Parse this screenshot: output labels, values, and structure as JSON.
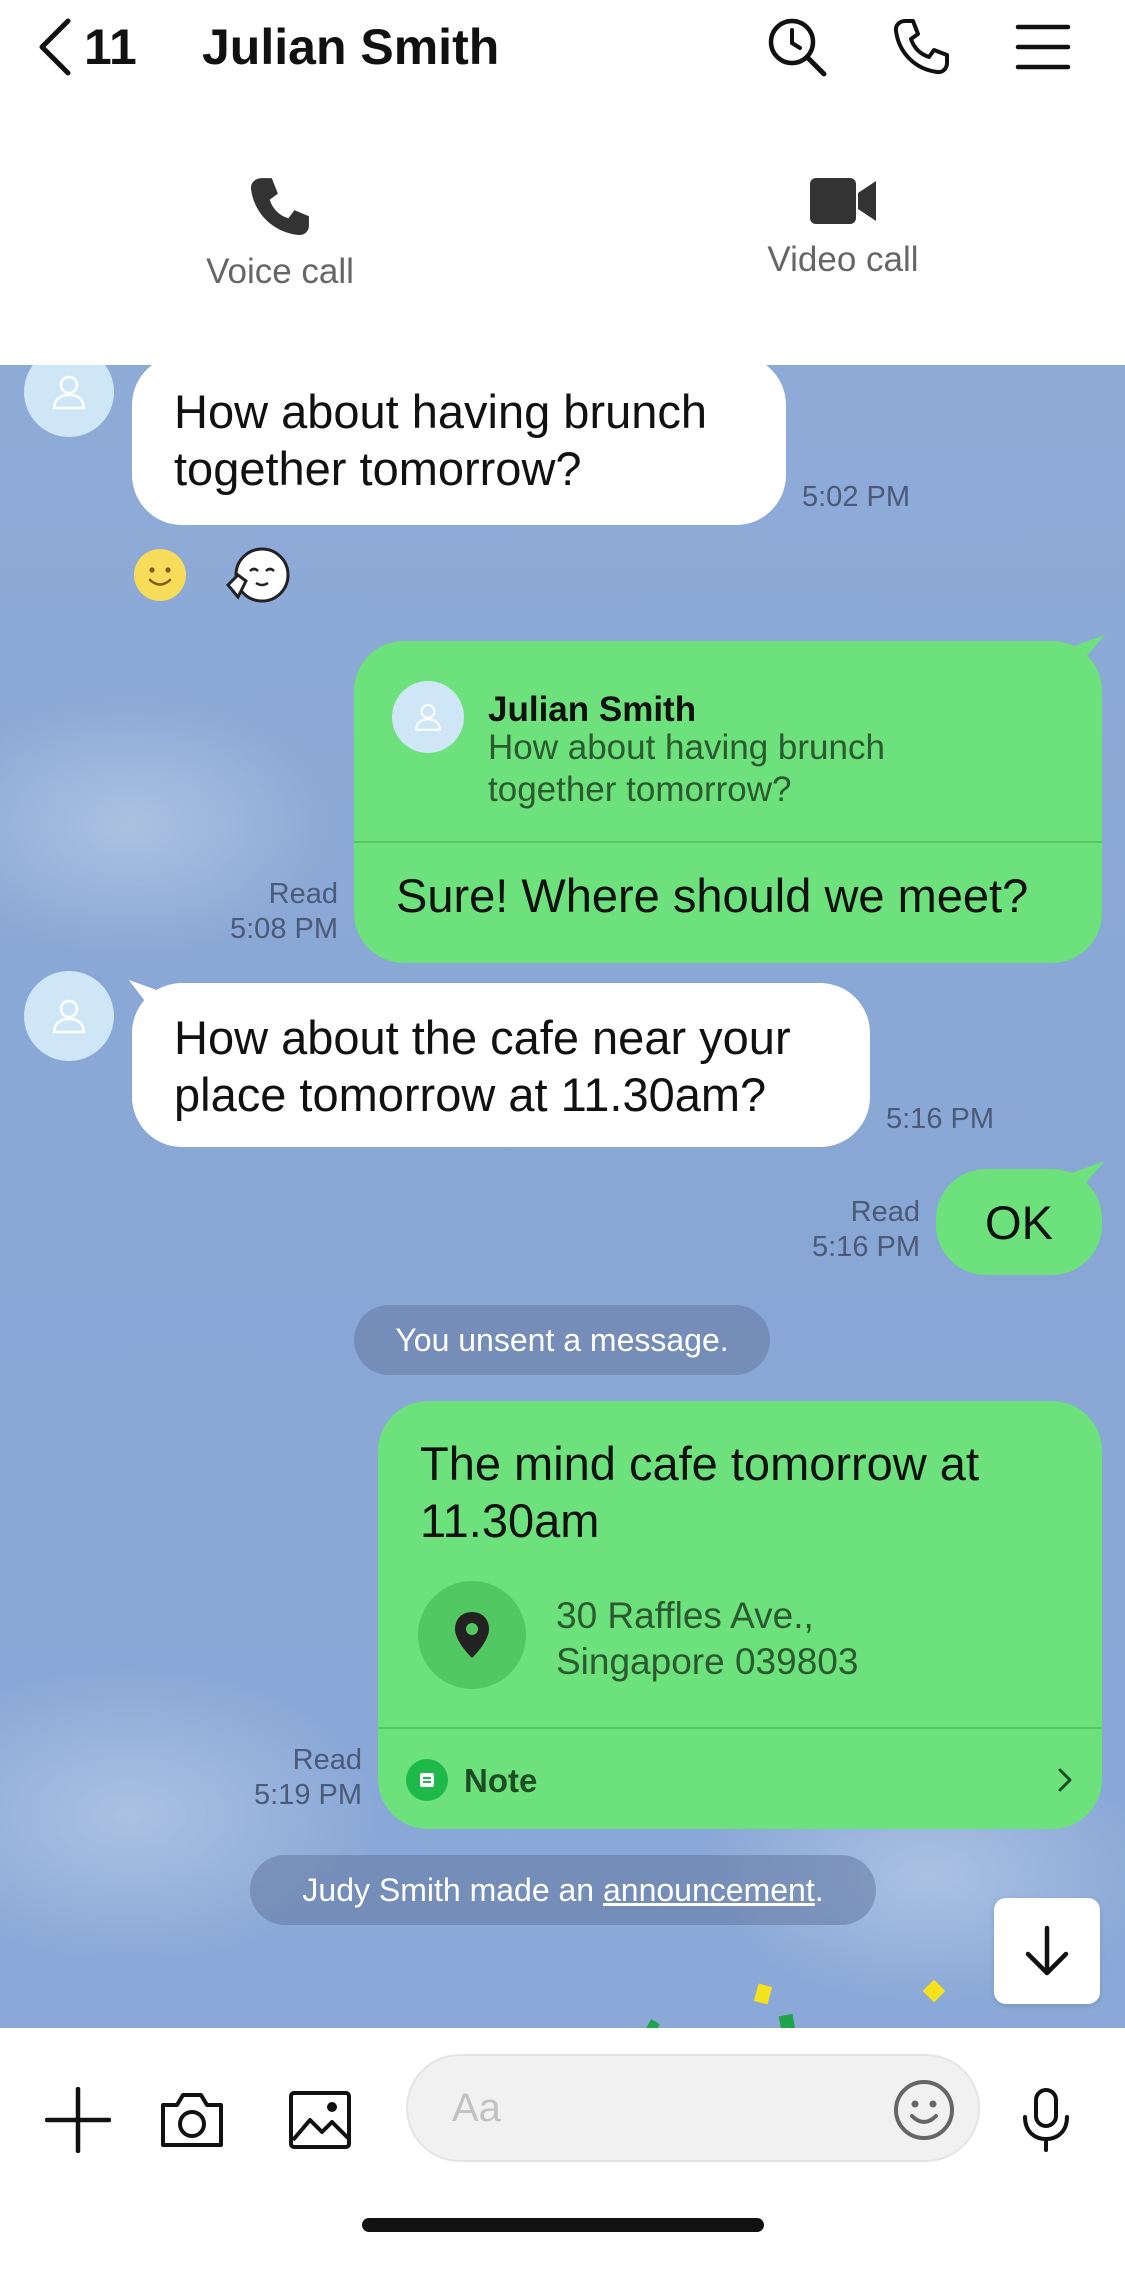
{
  "header": {
    "back_count": "11",
    "title": "Julian Smith",
    "icons": [
      "search-clock-icon",
      "phone-icon",
      "menu-icon"
    ]
  },
  "call_options": {
    "voice_label": "Voice call",
    "video_label": "Video call"
  },
  "messages": [
    {
      "direction": "incoming",
      "text_line1": "How about having brunch",
      "text_line2": "together tomorrow?",
      "time": "5:02 PM",
      "reactions": [
        "smile-emoji-icon",
        "sticker-face-icon"
      ]
    },
    {
      "direction": "outgoing",
      "quote_name": "Julian Smith",
      "quote_line1": "How about having brunch",
      "quote_line2": "together tomorrow?",
      "text": "Sure! Where should we meet?",
      "read_label": "Read",
      "time": "5:08 PM"
    },
    {
      "direction": "incoming",
      "text_line1": "How about the cafe near your",
      "text_line2": "place tomorrow at 11.30am?",
      "time": "5:16 PM"
    },
    {
      "direction": "outgoing",
      "text": "OK",
      "read_label": "Read",
      "time": "5:16 PM"
    },
    {
      "type": "system",
      "text": "You unsent a message."
    },
    {
      "direction": "outgoing",
      "title_line1": "The mind cafe tomorrow at",
      "title_line2": "11.30am",
      "address_line1": "30 Raffles Ave.,",
      "address_line2": "Singapore 039803",
      "note_label": "Note",
      "read_label": "Read",
      "time": "5:19 PM"
    },
    {
      "type": "system",
      "text_prefix": "Judy Smith made an ",
      "link_text": "announcement",
      "text_suffix": "."
    }
  ],
  "input": {
    "placeholder": "Aa"
  },
  "colors": {
    "chat_background": "#8eabd8",
    "incoming_bubble": "#ffffff",
    "outgoing_bubble": "#6de17b",
    "accent_green": "#1fb84a"
  }
}
